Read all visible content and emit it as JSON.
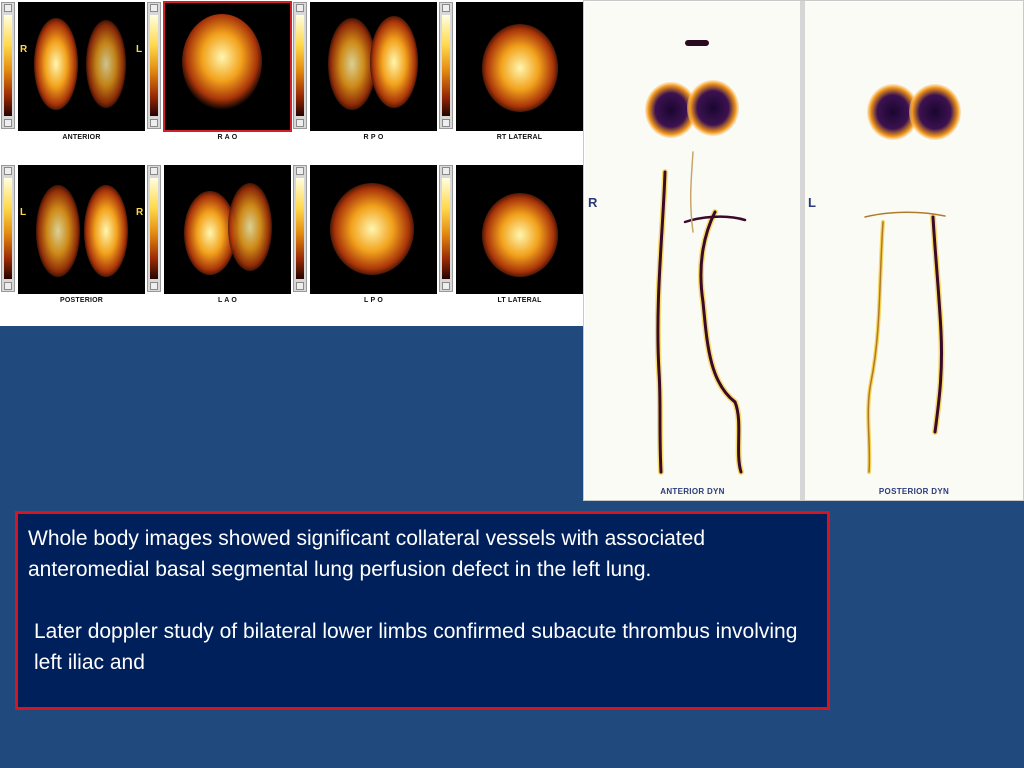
{
  "lung_views": {
    "colors": {
      "hot": "#fff6b0",
      "mid": "#f2a21c",
      "cool": "#a8340a",
      "bg": "#000000"
    },
    "row1": [
      {
        "label": "ANTERIOR",
        "side_marks": [
          "R",
          "L"
        ]
      },
      {
        "label": "R A O",
        "side_marks": []
      },
      {
        "label": "R P O",
        "side_marks": []
      },
      {
        "label": "RT LATERAL",
        "side_marks": []
      }
    ],
    "row2": [
      {
        "label": "POSTERIOR",
        "side_marks": [
          "L",
          "R"
        ]
      },
      {
        "label": "L A O",
        "side_marks": []
      },
      {
        "label": "L P O",
        "side_marks": []
      },
      {
        "label": "LT LATERAL",
        "side_marks": []
      }
    ]
  },
  "whole_body": {
    "anterior": {
      "label": "ANTERIOR DYN",
      "side_mark": "R"
    },
    "posterior": {
      "label": "POSTERIOR DYN",
      "side_mark": "L"
    },
    "colors": {
      "vessel": "#3a0a2a",
      "halo": "#f5c518",
      "lung": "#1a0630"
    }
  },
  "caption": {
    "paragraph1": "Whole body images showed significant collateral vessels with associated anteromedial basal segmental lung perfusion defect in the left lung.",
    "paragraph2": "Later doppler study of bilateral lower limbs confirmed subacute thrombus involving left iliac and"
  }
}
